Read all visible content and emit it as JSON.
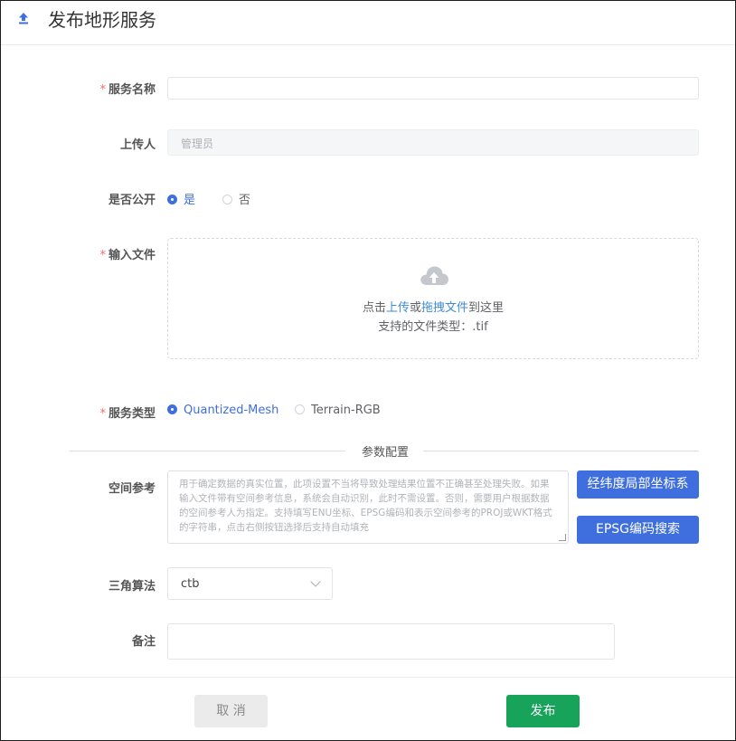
{
  "header": {
    "title": "发布地形服务",
    "icon": "upload-icon"
  },
  "form": {
    "service_name": {
      "required_mark": "*",
      "label": "服务名称",
      "value": ""
    },
    "uploader": {
      "label": "上传人",
      "value": "管理员"
    },
    "is_public": {
      "label": "是否公开",
      "options": [
        {
          "label": "是",
          "checked": true
        },
        {
          "label": "否",
          "checked": false
        }
      ]
    },
    "input_file": {
      "required_mark": "*",
      "label": "输入文件",
      "icon": "cloud-upload-icon",
      "prefix": "点击",
      "upload_link": "上传",
      "or": "或",
      "drag_link": "拖拽文件",
      "suffix": "到这里",
      "types_hint": "支持的文件类型：.tif"
    },
    "service_type": {
      "required_mark": "*",
      "label": "服务类型",
      "options": [
        {
          "label": "Quantized-Mesh",
          "checked": true
        },
        {
          "label": "Terrain-RGB",
          "checked": false
        }
      ]
    },
    "section_divider": "参数配置",
    "spatial_ref": {
      "label": "空间参考",
      "placeholder": "用于确定数据的真实位置，此项设置不当将导致处理结果位置不正确甚至处理失败。如果输入文件带有空间参考信息，系统会自动识别，此时不需设置。否则，需要用户根据数据的空间参考人为指定。支持填写ENU坐标、EPSG编码和表示空间参考的PROJ或WKT格式的字符串，点击右侧按钮选择后支持自动填充",
      "btn_local": "经纬度局部坐标系",
      "btn_epsg": "EPSG编码搜索"
    },
    "triangle_algo": {
      "label": "三角算法",
      "value": "ctb"
    },
    "remark": {
      "label": "备注",
      "value": ""
    }
  },
  "footer": {
    "cancel": "取 消",
    "submit": "发布"
  },
  "colors": {
    "primary": "#3f6fde",
    "success": "#18a35a",
    "required": "#f56c6c",
    "link": "#3f8bd6"
  }
}
